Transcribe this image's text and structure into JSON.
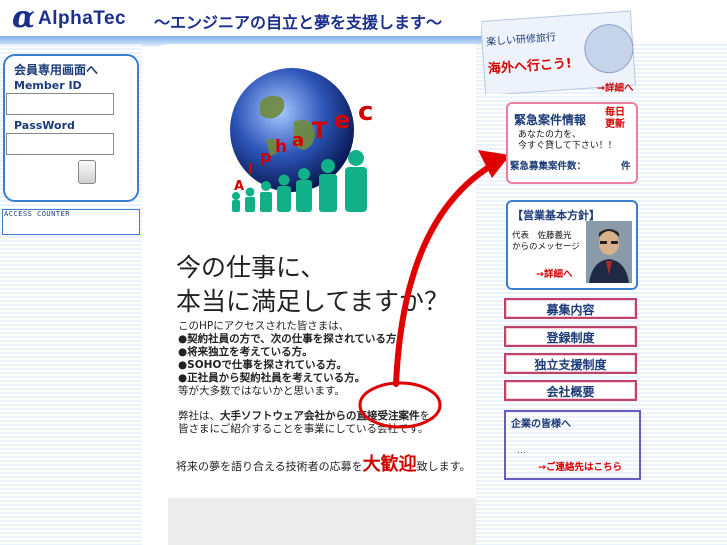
{
  "header": {
    "logo_mark": "α",
    "logo_text": "AlphaTec",
    "tagline": "～エンジニアの自立と夢を支援します～"
  },
  "login": {
    "title": "会員専用画面へ",
    "member_label": "Member ID",
    "member_value": "",
    "password_label": "PassWord",
    "password_value": ""
  },
  "counter": {
    "label": "ACCESS COUNTER"
  },
  "globe": {
    "letters": [
      "A",
      "l",
      "p",
      "h",
      "a",
      "T",
      "e",
      "c"
    ]
  },
  "main": {
    "headline_1": "今の仕事に、",
    "headline_2": "本当に満足してますか？",
    "intro": "このHPにアクセスされた皆さまは、",
    "bullets": [
      "●契約社員の方で、次の仕事を探されている方。",
      "●将来独立を考えている方。",
      "●SOHOで仕事を探されている方。",
      "●正社員から契約社員を考えている方。"
    ],
    "closing": "等が大多数ではないかと思います。",
    "biz_1a": "弊社は、",
    "biz_1b": "大手ソフトウェア会社からの直接受注案件",
    "biz_1c": "を、",
    "biz_2": "皆さまにご紹介することを事業にしている会社です。",
    "welcome_pre": "将来の夢を語り合える技術者の応募を",
    "welcome_big": "大歓迎",
    "welcome_post": "致します。"
  },
  "trip": {
    "line1": "楽しい研修旅行",
    "line2": "海外へ行こう!",
    "detail": "→詳細へ"
  },
  "urgent": {
    "title": "緊急案件情報",
    "daily_1": "毎日",
    "daily_2": "更新",
    "line1": "あなたの力を、",
    "line2": "今すぐ貸して下さい！！",
    "count_label": "緊急募集案件数：",
    "count_unit": "件"
  },
  "policy": {
    "title": "【営業基本方針】",
    "rep": "代表　佐藤義光",
    "msg": "からのメッセージ",
    "detail": "→詳細へ"
  },
  "nav": [
    {
      "label": "募集内容"
    },
    {
      "label": "登録制度"
    },
    {
      "label": "独立支援制度"
    },
    {
      "label": "会社概要"
    }
  ],
  "contact": {
    "title": "企業の皆様へ",
    "dots": "…",
    "link": "→ご連絡先はこちら"
  },
  "colors": {
    "brand": "#1b2f8c",
    "accent_red": "#d40000",
    "border_blue": "#3c7fd0",
    "border_pink": "#c0446a"
  }
}
